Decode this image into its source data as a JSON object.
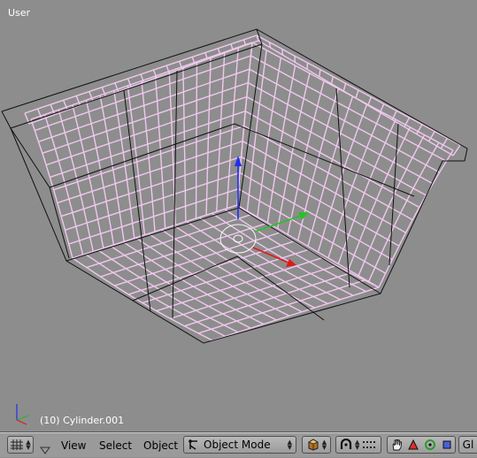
{
  "viewport": {
    "view_label": "User",
    "object_label": "(10) Cylinder.001",
    "mesh_color": "#f0c8ee",
    "cage_color": "#111111",
    "background_color": "#8d8d8d"
  },
  "header": {
    "menus": {
      "view": "View",
      "select": "Select",
      "object": "Object"
    },
    "mode": {
      "label": "Object Mode",
      "icon": "object-mode-icon"
    },
    "right_text": "Gl"
  }
}
